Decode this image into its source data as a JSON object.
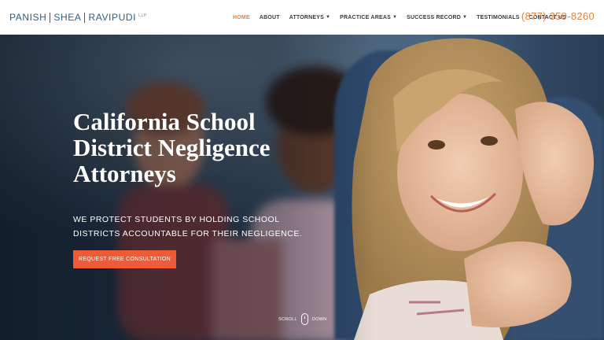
{
  "brand": {
    "name_parts": [
      "PANISH",
      "SHEA",
      "RAVIPUDI"
    ],
    "suffix": "LLP"
  },
  "nav": {
    "items": [
      {
        "label": "HOME",
        "active": true
      },
      {
        "label": "ABOUT"
      },
      {
        "label": "ATTORNEYS",
        "dropdown": true
      },
      {
        "label": "PRACTICE AREAS",
        "dropdown": true
      },
      {
        "label": "SUCCESS RECORD",
        "dropdown": true
      },
      {
        "label": "TESTIMONIALS"
      },
      {
        "label": "CONTACT US"
      }
    ],
    "phone": "(877) 359-8260"
  },
  "hero": {
    "title": "California School District Negligence Attorneys",
    "subtitle": "WE PROTECT STUDENTS BY HOLDING SCHOOL DISTRICTS ACCOUNTABLE FOR THEIR NEGLIGENCE.",
    "cta_label": "REQUEST FREE CONSULTATION",
    "scroll_left": "SCROLL",
    "scroll_right": "DOWN"
  },
  "colors": {
    "accent": "#e8823a",
    "cta": "#ef5b36",
    "brand": "#2f5d8a"
  }
}
